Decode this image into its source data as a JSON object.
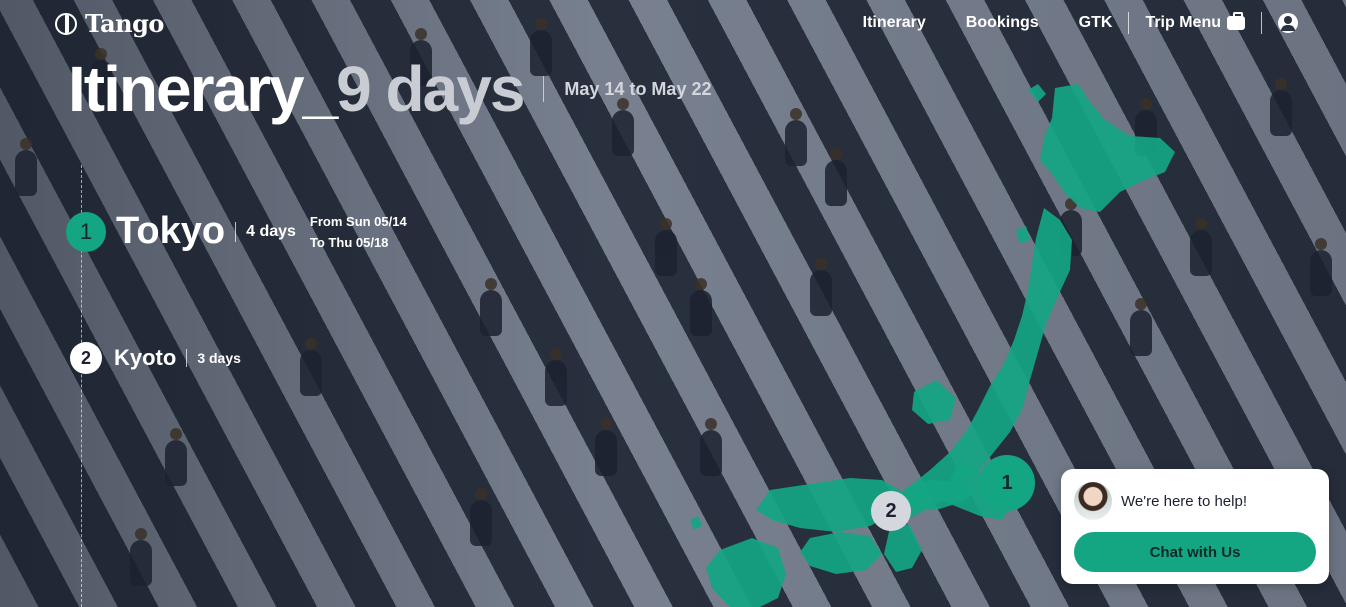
{
  "header": {
    "logo_text": "Tango",
    "nav": {
      "itinerary": "Itinerary",
      "bookings": "Bookings",
      "gtk": "GTK",
      "trip_menu": "Trip Menu"
    },
    "icons": {
      "logo": "tango-logo-icon",
      "trip_menu": "briefcase-icon",
      "account": "account-icon"
    }
  },
  "title": {
    "main": "Itinerary_",
    "sub": "9 days",
    "dates": "May 14 to May 22"
  },
  "stops": [
    {
      "number": "1",
      "city": "Tokyo",
      "duration": "4 days",
      "from": "From Sun 05/14",
      "to": "To Thu 05/18"
    },
    {
      "number": "2",
      "city": "Kyoto",
      "duration": "3 days"
    }
  ],
  "map": {
    "pins": [
      "1",
      "2"
    ],
    "colors": {
      "land": "#14a583",
      "active_pin": "#14a583",
      "inactive_pin": "#d4d7dd"
    }
  },
  "chat": {
    "message": "We're here to help!",
    "button": "Chat with Us"
  },
  "colors": {
    "accent": "#14a583",
    "background": "#2b3240"
  }
}
